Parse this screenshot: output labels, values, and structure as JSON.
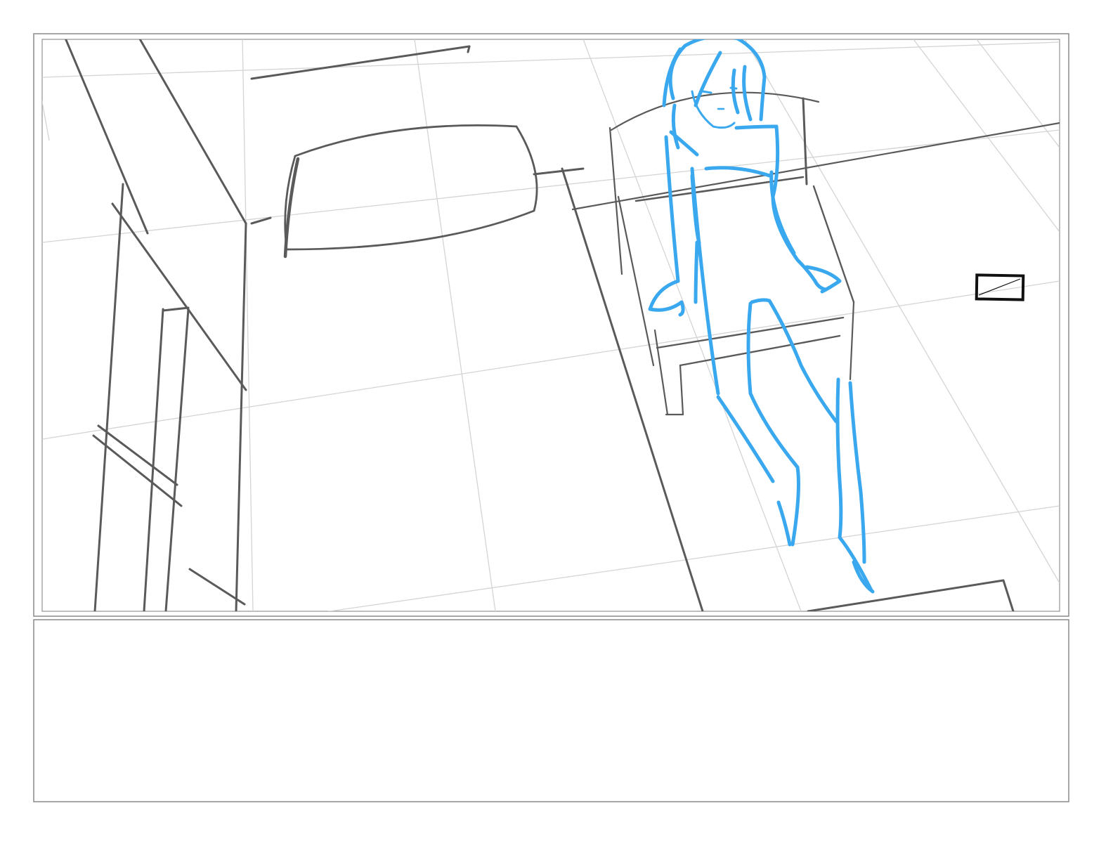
{
  "sheet": {
    "panel_count": 2,
    "colors": {
      "frame": "#8a8a8a",
      "pencil": "#5a5a5a",
      "guide": "#d4d4d4",
      "figure": "#3aa8ee",
      "marker": "#111111"
    }
  },
  "panels": [
    {
      "role": "image-panel",
      "content": "pencil-layout-sketch",
      "figure_color": "#3aa8ee"
    },
    {
      "role": "notes-panel",
      "content": "empty"
    }
  ]
}
